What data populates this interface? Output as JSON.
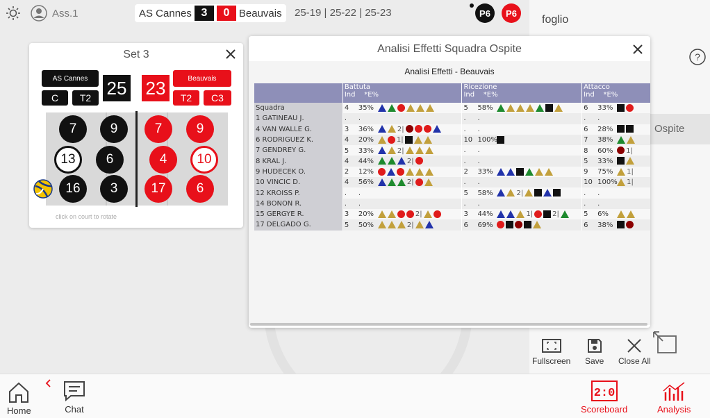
{
  "topbar": {
    "user": "Ass.1",
    "home_team": "AS Cannes",
    "home_sets": "3",
    "away_sets": "0",
    "away_team": "Beauvais",
    "set_scores": "25-19 | 25-22 | 25-23",
    "p_home": "P6",
    "p_away": "P6"
  },
  "rightpanel": {
    "title": "foglio",
    "partial_item": "Ospite"
  },
  "setpanel": {
    "title": "Set 3",
    "home_team": "AS Cannes",
    "home_score": "25",
    "home_btn_c": "C",
    "home_btn_t2": "T2",
    "away_team": "Beauvais",
    "away_score": "23",
    "away_btn_t2": "T2",
    "away_btn_c3": "C3",
    "home_players": [
      "7",
      "9",
      "13",
      "6",
      "16",
      "3"
    ],
    "away_players": [
      "7",
      "9",
      "4",
      "10",
      "17",
      "6"
    ],
    "hint": "click on court to rotate"
  },
  "analysis": {
    "title": "Analisi Effetti Squadra Ospite",
    "subtitle": "Analisi Effetti - Beauvais",
    "groups": [
      "Battuta",
      "Ricezione",
      "Attacco"
    ],
    "subhead_ind": "Ind",
    "subhead_pct": "*E%",
    "rows": [
      {
        "name": "Squadra",
        "b_ind": "4",
        "b_pct": "35%",
        "b_icons": "bgr yyy",
        "r_ind": "5",
        "r_pct": "58%",
        "r_icons": "gyy ygk y",
        "a_ind": "6",
        "a_pct": "33%",
        "a_icons": "kr"
      },
      {
        "name": "1 GATINEAU J.",
        "b_ind": ".",
        "b_pct": ".",
        "b_icons": "",
        "r_ind": ".",
        "r_pct": ".",
        "r_icons": "",
        "a_ind": ".",
        "a_pct": ".",
        "a_icons": ""
      },
      {
        "name": "4 VAN WALLE G.",
        "b_ind": "3",
        "b_pct": "36%",
        "b_icons": "by|2 drrb",
        "r_ind": ".",
        "r_pct": ".",
        "r_icons": "",
        "a_ind": "6",
        "a_pct": "28%",
        "a_icons": "kk"
      },
      {
        "name": "6 RODRIGUEZ K.",
        "b_ind": "4",
        "b_pct": "20%",
        "b_icons": "yr|1 kyy",
        "r_ind": "10",
        "r_pct": "100%",
        "r_icons": "k",
        "a_ind": "7",
        "a_pct": "38%",
        "a_icons": "gy"
      },
      {
        "name": "7 GENDREY G.",
        "b_ind": "5",
        "b_pct": "33%",
        "b_icons": "by|2 yyy",
        "r_ind": ".",
        "r_pct": ".",
        "r_icons": "",
        "a_ind": "8",
        "a_pct": "60%",
        "a_icons": "d|1"
      },
      {
        "name": "8 KRAL J.",
        "b_ind": "4",
        "b_pct": "44%",
        "b_icons": "ggb|2 r",
        "r_ind": ".",
        "r_pct": ".",
        "r_icons": "",
        "a_ind": "5",
        "a_pct": "33%",
        "a_icons": "ky"
      },
      {
        "name": "9 HUDECEK O.",
        "b_ind": "2",
        "b_pct": "12%",
        "b_icons": "rbry yy",
        "r_ind": "2",
        "r_pct": "33%",
        "r_icons": "bbk gyy",
        "a_ind": "9",
        "a_pct": "75%",
        "a_icons": "y|1"
      },
      {
        "name": "10 VINCIC D.",
        "b_ind": "4",
        "b_pct": "56%",
        "b_icons": "bgg|2 ry",
        "r_ind": ".",
        "r_pct": ".",
        "r_icons": "",
        "a_ind": "10",
        "a_pct": "100%",
        "a_icons": "y|1"
      },
      {
        "name": "12 KROISS P.",
        "b_ind": ".",
        "b_pct": ".",
        "b_icons": "",
        "r_ind": "5",
        "r_pct": "58%",
        "r_icons": "by|2 ykbk",
        "a_ind": ".",
        "a_pct": ".",
        "a_icons": ""
      },
      {
        "name": "14 BONON R.",
        "b_ind": ".",
        "b_pct": ".",
        "b_icons": "",
        "r_ind": ".",
        "r_pct": ".",
        "r_icons": "",
        "a_ind": ".",
        "a_pct": ".",
        "a_icons": ""
      },
      {
        "name": "15 GERGYE R.",
        "b_ind": "3",
        "b_pct": "20%",
        "b_icons": "yyrr|2 yr",
        "r_ind": "3",
        "r_pct": "44%",
        "r_icons": "bby|1 rk|2 g",
        "a_ind": "5",
        "a_pct": "6%",
        "a_icons": "yy"
      },
      {
        "name": "17 DELGADO G.",
        "b_ind": "5",
        "b_pct": "50%",
        "b_icons": "yyy|2 yb",
        "r_ind": "6",
        "r_pct": "69%",
        "r_icons": "rkdk y",
        "a_ind": "6",
        "a_pct": "38%",
        "a_icons": "kd"
      }
    ]
  },
  "actions": {
    "fullscreen": "Fullscreen",
    "save": "Save",
    "close_all": "Close All"
  },
  "bottombar": {
    "home": "Home",
    "chat": "Chat",
    "scoreboard": "Scoreboard",
    "analysis": "Analysis"
  },
  "colors": {
    "accent": "#e8101a",
    "dark": "#111111",
    "header_band": "#8e8fb8"
  }
}
